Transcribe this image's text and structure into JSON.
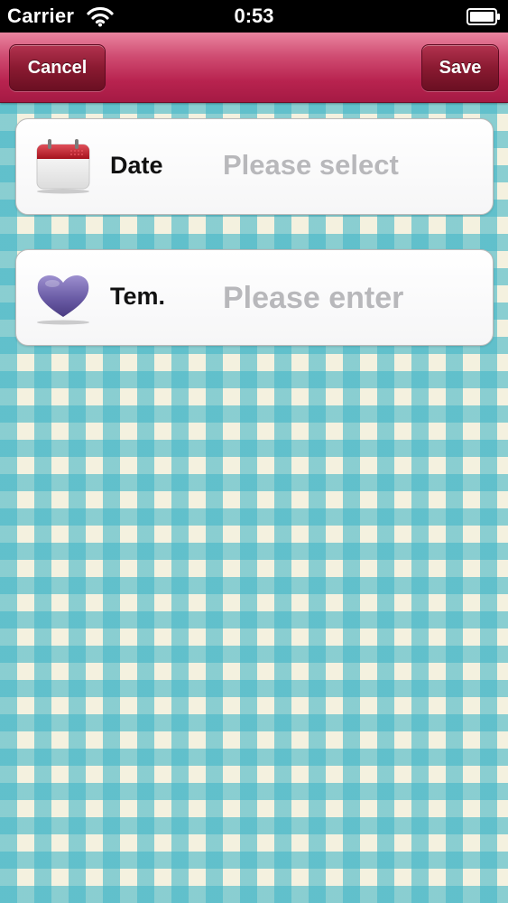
{
  "status_bar": {
    "carrier": "Carrier",
    "time": "0:53",
    "wifi_icon": "wifi-icon",
    "battery_icon": "battery-icon"
  },
  "nav": {
    "cancel_label": "Cancel",
    "save_label": "Save",
    "colors": {
      "bar": "#b8234f",
      "button": "#7e1529"
    }
  },
  "form": {
    "rows": [
      {
        "icon": "calendar-icon",
        "label": "Date",
        "value_placeholder": "Please select"
      },
      {
        "icon": "heart-icon",
        "label": "Tem.",
        "value_placeholder": "Please enter"
      }
    ]
  },
  "background": {
    "pattern": "gingham",
    "color_primary": "#48b8c8",
    "color_secondary": "#f4f1df"
  }
}
